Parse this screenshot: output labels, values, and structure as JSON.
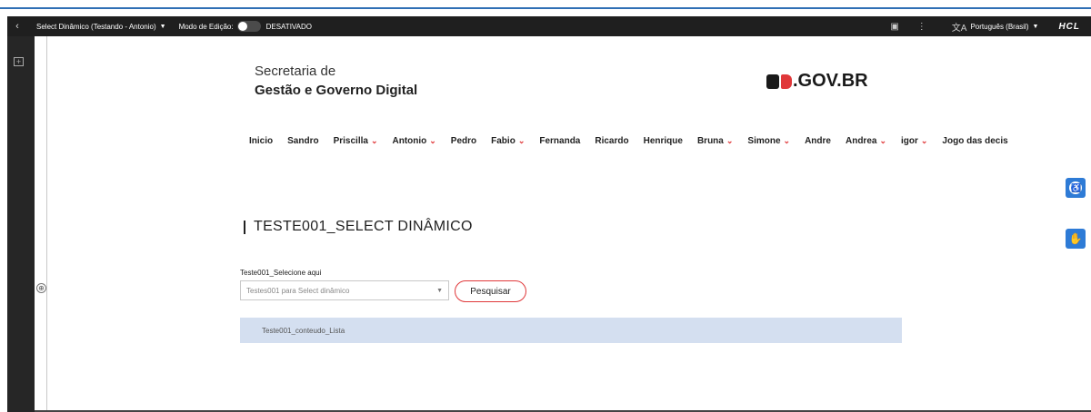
{
  "toolbar": {
    "back_icon": "chevron-left-icon",
    "page_selector": "Select Dinâmico (Testando - Antonio)",
    "edit_mode_label": "Modo de Edição:",
    "edit_mode_state": "DESATIVADO",
    "language": "Português (Brasil)",
    "brand": "HCL"
  },
  "header": {
    "org_line1": "Secretaria de",
    "org_line2": "Gestão e Governo Digital",
    "logo_text": ".GOV.BR"
  },
  "nav": {
    "items": [
      {
        "label": "Inicio",
        "dropdown": false
      },
      {
        "label": "Sandro",
        "dropdown": false
      },
      {
        "label": "Priscilla",
        "dropdown": true
      },
      {
        "label": "Antonio",
        "dropdown": true
      },
      {
        "label": "Pedro",
        "dropdown": false
      },
      {
        "label": "Fabio",
        "dropdown": true
      },
      {
        "label": "Fernanda",
        "dropdown": false
      },
      {
        "label": "Ricardo",
        "dropdown": false
      },
      {
        "label": "Henrique",
        "dropdown": false
      },
      {
        "label": "Bruna",
        "dropdown": true
      },
      {
        "label": "Simone",
        "dropdown": true
      },
      {
        "label": "Andre",
        "dropdown": false
      },
      {
        "label": "Andrea",
        "dropdown": true
      },
      {
        "label": "igor",
        "dropdown": true
      },
      {
        "label": "Jogo das decis",
        "dropdown": false
      }
    ]
  },
  "main": {
    "title": "TESTE001_SELECT DINÂMICO",
    "select_label": "Teste001_Selecione aqui",
    "select_value": "Testes001 para Select dinâmico",
    "search_button": "Pesquisar",
    "result_text": "Teste001_conteudo_Lista"
  },
  "colors": {
    "accent_red": "#e0383a",
    "accent_blue": "#2e7bd6",
    "result_bg": "#d4dff0",
    "toolbar_bg": "#1f1f1f"
  }
}
